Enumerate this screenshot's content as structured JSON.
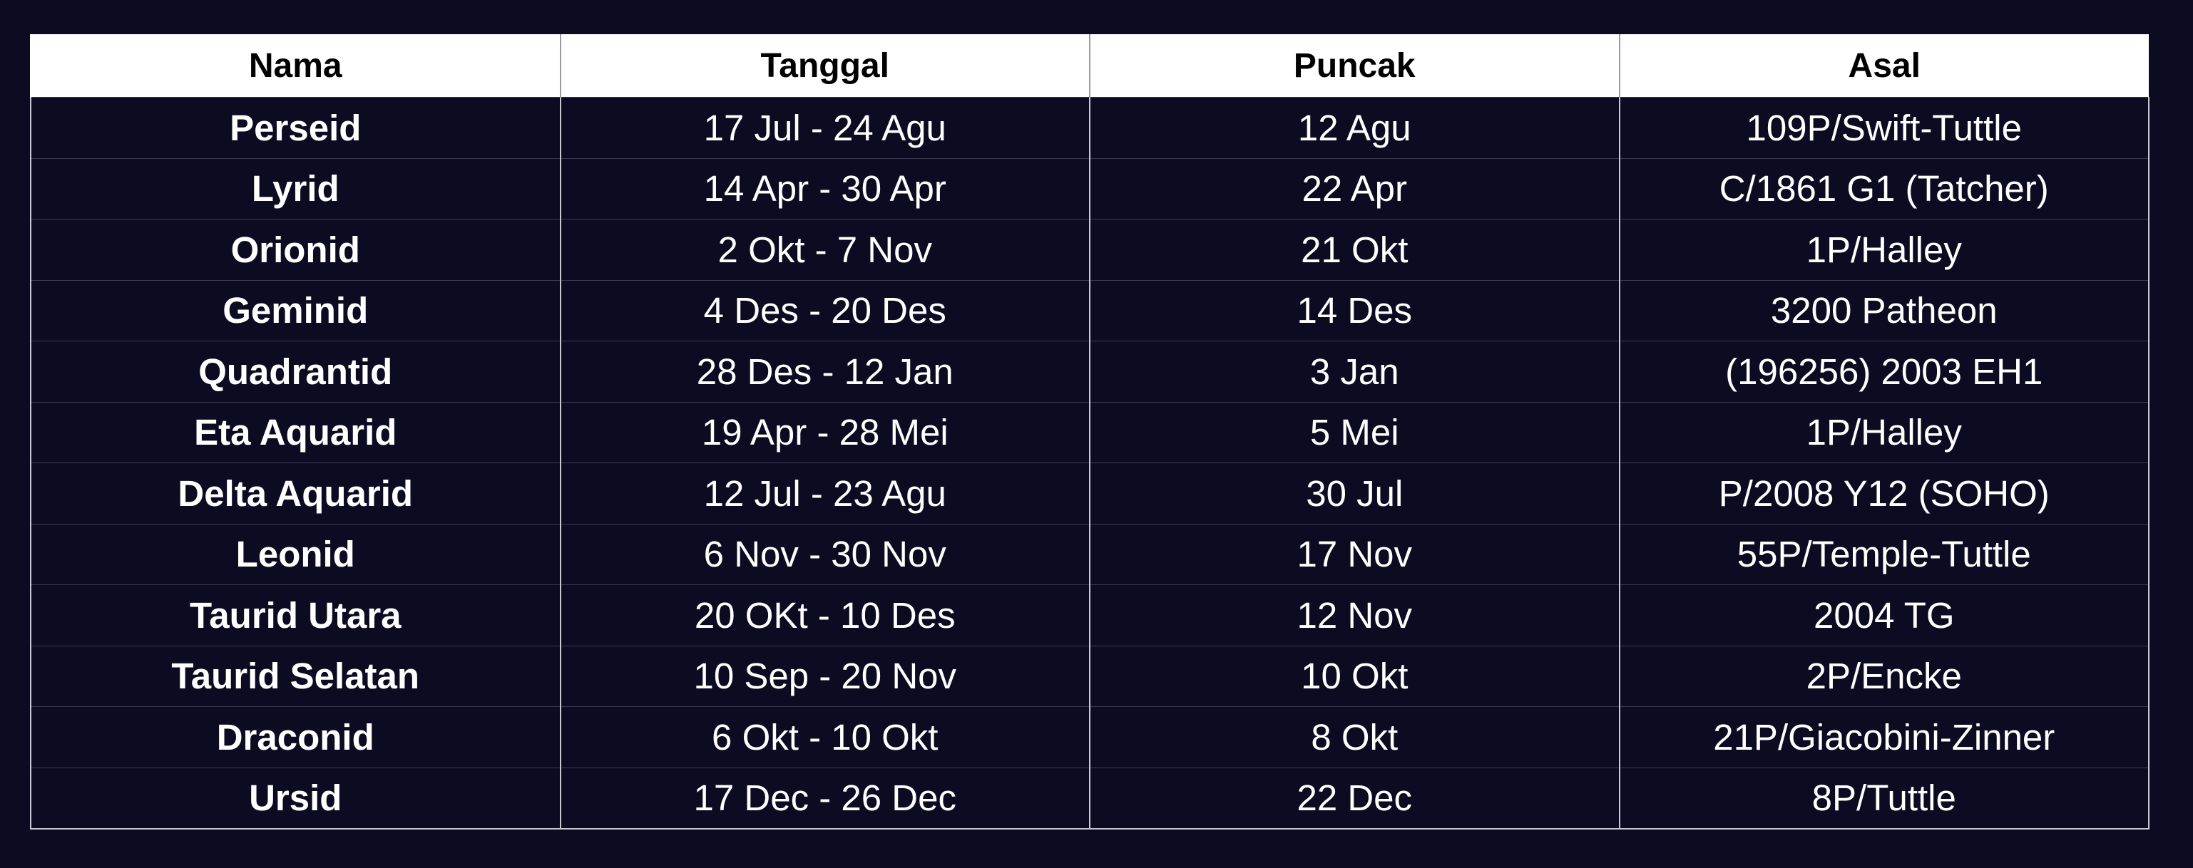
{
  "table": {
    "headers": [
      "Nama",
      "Tanggal",
      "Puncak",
      "Asal"
    ],
    "rows": [
      [
        "Perseid",
        "17 Jul - 24 Agu",
        "12 Agu",
        "109P/Swift-Tuttle"
      ],
      [
        "Lyrid",
        "14 Apr - 30 Apr",
        "22 Apr",
        "C/1861 G1 (Tatcher)"
      ],
      [
        "Orionid",
        "2 Okt - 7 Nov",
        "21 Okt",
        "1P/Halley"
      ],
      [
        "Geminid",
        "4 Des - 20 Des",
        "14 Des",
        "3200 Patheon"
      ],
      [
        "Quadrantid",
        "28 Des - 12 Jan",
        "3 Jan",
        "(196256) 2003 EH1"
      ],
      [
        "Eta Aquarid",
        "19 Apr - 28 Mei",
        "5 Mei",
        "1P/Halley"
      ],
      [
        "Delta Aquarid",
        "12 Jul - 23 Agu",
        "30 Jul",
        "P/2008 Y12 (SOHO)"
      ],
      [
        "Leonid",
        "6 Nov - 30 Nov",
        "17 Nov",
        "55P/Temple-Tuttle"
      ],
      [
        "Taurid Utara",
        "20 OKt - 10 Des",
        "12 Nov",
        "2004 TG"
      ],
      [
        "Taurid Selatan",
        "10 Sep - 20 Nov",
        "10 Okt",
        "2P/Encke"
      ],
      [
        "Draconid",
        "6 Okt - 10 Okt",
        "8 Okt",
        "21P/Giacobini-Zinner"
      ],
      [
        "Ursid",
        "17 Dec - 26 Dec",
        "22 Dec",
        "8P/Tuttle"
      ]
    ]
  },
  "colors": {
    "background": "#0b0b22",
    "header_background": "#ffffff",
    "header_text": "#000000",
    "cell_text": "#ffffff"
  }
}
